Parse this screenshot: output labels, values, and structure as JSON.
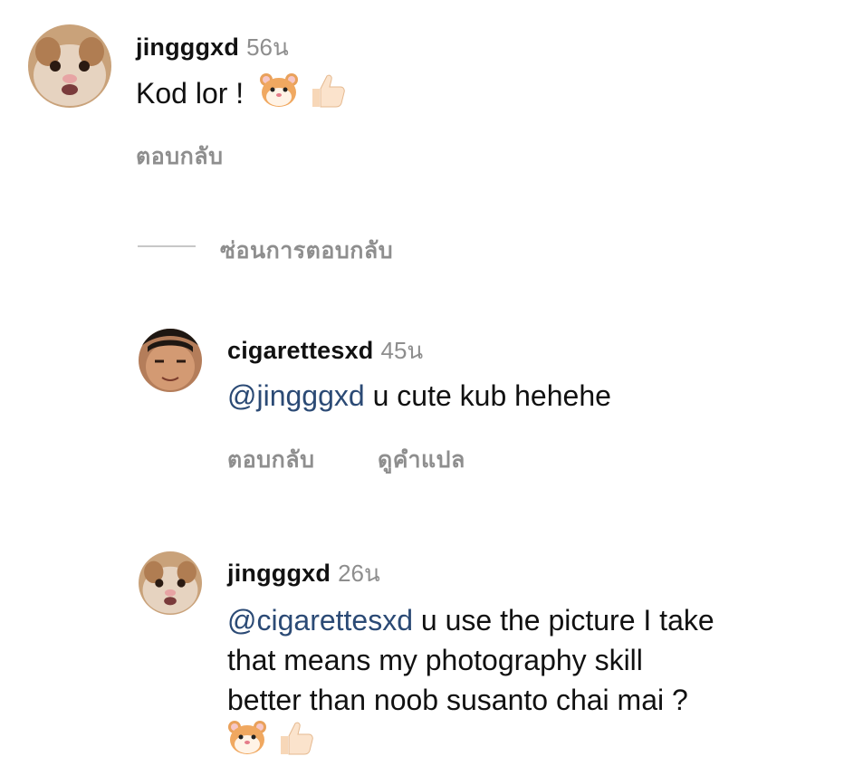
{
  "comment1": {
    "username": "jingggxd",
    "time": "56น",
    "text": "Kod lor !",
    "reply_label": "ตอบกลับ",
    "avatar": "hamster-avatar",
    "emojis": [
      "hamster-face-icon",
      "thumbs-up-icon"
    ]
  },
  "hide_replies_label": "ซ่อนการตอบกลับ",
  "reply1": {
    "username": "cigarettesxd",
    "time": "45น",
    "mention": "@jingggxd",
    "text": " u cute kub hehehe",
    "reply_label": "ตอบกลับ",
    "translate_label": "ดูคำแปล",
    "avatar": "man-face-avatar"
  },
  "reply2": {
    "username": "jingggxd",
    "time": "26น",
    "mention": "@cigarettesxd",
    "line1": " u use the picture I take",
    "line2": "that means my photography skill",
    "line3": "better than noob susanto chai mai ?",
    "avatar": "hamster-avatar",
    "emojis": [
      "hamster-face-icon",
      "thumbs-up-icon"
    ]
  }
}
